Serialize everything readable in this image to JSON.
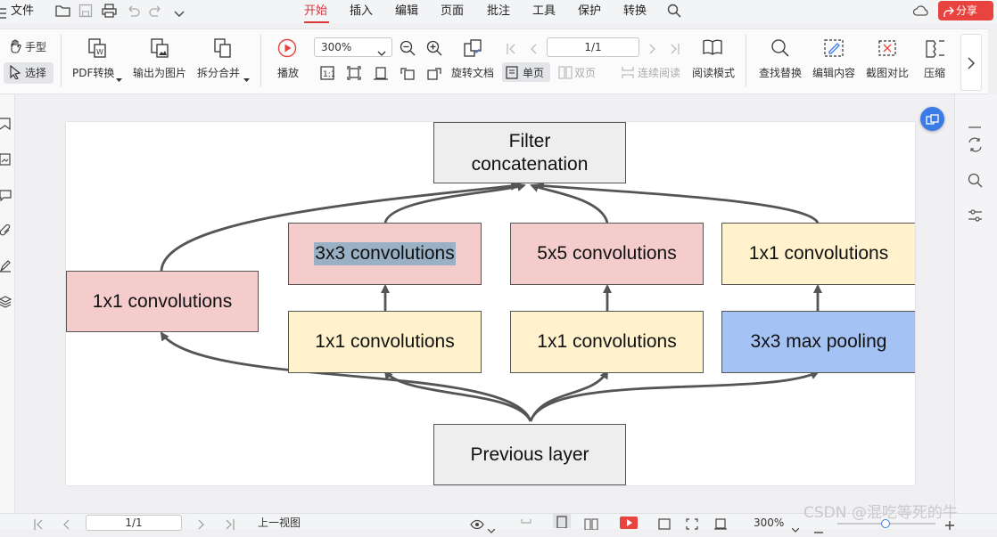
{
  "menu": {
    "file": "文件",
    "tabs": [
      {
        "label": "开始",
        "active": true
      },
      {
        "label": "插入"
      },
      {
        "label": "编辑"
      },
      {
        "label": "页面"
      },
      {
        "label": "批注"
      },
      {
        "label": "工具"
      },
      {
        "label": "保护"
      },
      {
        "label": "转换"
      }
    ],
    "share": "分享"
  },
  "toolbar": {
    "hand": "手型",
    "select": "选择",
    "pdf_convert": "PDF转换",
    "export_image": "输出为图片",
    "split_merge": "拆分合并",
    "play": "播放",
    "zoom": "300%",
    "rotate_doc": "旋转文档",
    "page_input": "1/1",
    "single_page": "单页",
    "double_page": "双页",
    "continuous": "连续阅读",
    "read_mode": "阅读模式",
    "find_replace": "查找替换",
    "edit_content": "编辑内容",
    "screenshot_compare": "截图对比",
    "compress": "压缩"
  },
  "diagram": {
    "filter": "Filter\nconcatenation",
    "previous": "Previous layer",
    "conv1x1": "1x1 convolutions",
    "conv3x3": "3x3 convolutions",
    "conv5x5": "5x5 convolutions",
    "maxpool": "3x3 max pooling"
  },
  "status": {
    "page": "1/1",
    "prev_view": "上一视图",
    "zoom": "300%"
  },
  "watermark": "CSDN @混吃等死的牛",
  "colors": {
    "accent": "#d9363e",
    "pink": "#f4cccc",
    "yellow": "#fff2cc",
    "blue": "#a4c2f4",
    "gray": "#eeeeee"
  }
}
